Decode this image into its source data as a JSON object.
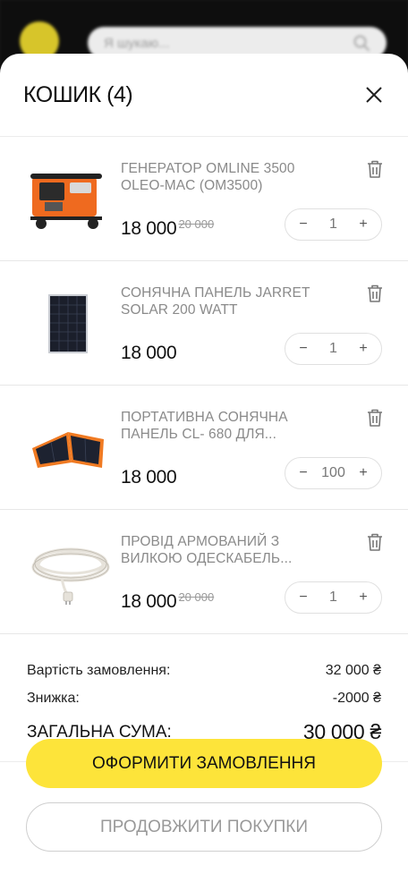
{
  "search": {
    "placeholder": "Я шукаю..."
  },
  "cart": {
    "title": "КОШИК (4)",
    "items": [
      {
        "name": "ГЕНЕРАТОР OMLINE 3500 OLEO-MAC (OM3500)",
        "price": "18 000",
        "old_price": "20 000",
        "qty": "1",
        "image": "generator-image"
      },
      {
        "name": "СОНЯЧНА ПАНЕЛЬ JARRET SOLAR 200 WATT",
        "price": "18 000",
        "old_price": "",
        "qty": "1",
        "image": "solar-panel-image"
      },
      {
        "name": "ПОРТАТИВНА СОНЯЧНА ПАНЕЛЬ CL- 680 ДЛЯ...",
        "price": "18 000",
        "old_price": "",
        "qty": "100",
        "image": "portable-solar-panel-image"
      },
      {
        "name": "ПРОВІД АРМОВАНИЙ З ВИЛКОЮ ОДЕСКАБЕЛЬ...",
        "price": "18 000",
        "old_price": "20 000",
        "qty": "1",
        "image": "cable-image"
      }
    ],
    "stepper": {
      "minus": "−",
      "plus": "+"
    }
  },
  "summary": {
    "order_cost_label": "Вартість замовлення:",
    "order_cost_value": "32 000 ₴",
    "discount_label": "Знижка:",
    "discount_value": "-2000 ₴",
    "total_label": "ЗАГАЛЬНА СУМА:",
    "total_value": "30 000 ₴"
  },
  "buttons": {
    "checkout": "ОФОРМИТИ ЗАМОВЛЕННЯ",
    "continue": "ПРОДОВЖИТИ ПОКУПКИ"
  },
  "colors": {
    "accent": "#fde43a",
    "muted_text": "#8a8a8a"
  }
}
